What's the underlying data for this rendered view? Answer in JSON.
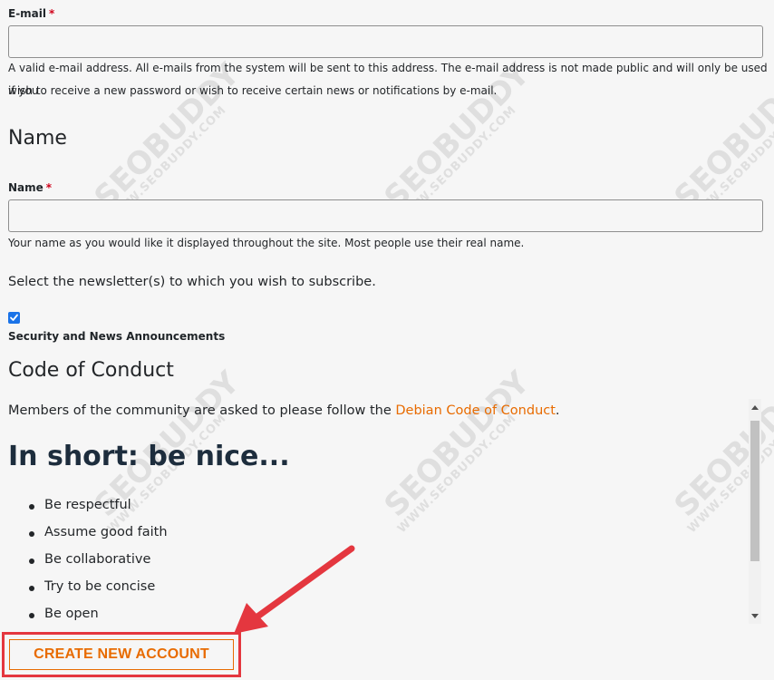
{
  "email": {
    "label": "E-mail",
    "required_mark": "*",
    "value": "",
    "help_line1": "A valid e-mail address. All e-mails from the system will be sent to this address. The e-mail address is not made public and will only be used if you",
    "help_line2": "wish to receive a new password or wish to receive certain news or notifications by e-mail."
  },
  "name_section": {
    "heading": "Name",
    "label": "Name",
    "required_mark": "*",
    "value": "",
    "help": "Your name as you would like it displayed throughout the site. Most people use their real name."
  },
  "newsletter": {
    "prompt": "Select the newsletter(s) to which you wish to subscribe.",
    "option_label": "Security and News Announcements",
    "checked": true
  },
  "conduct": {
    "heading": "Code of Conduct",
    "text_before": "Members of the community are asked to please follow the ",
    "link_text": "Debian Code of Conduct",
    "text_after": ".",
    "big_heading": "In short: be nice...",
    "items": [
      "Be respectful",
      "Assume good faith",
      "Be collaborative",
      "Try to be concise",
      "Be open"
    ]
  },
  "submit": {
    "label": "CREATE NEW ACCOUNT"
  },
  "watermark": {
    "brand": "SEOBUDDY",
    "url": "WWW.SEOBUDDY.COM"
  },
  "colors": {
    "accent": "#e86b00",
    "highlight": "#e4373f",
    "checkbox": "#1a73e8"
  }
}
